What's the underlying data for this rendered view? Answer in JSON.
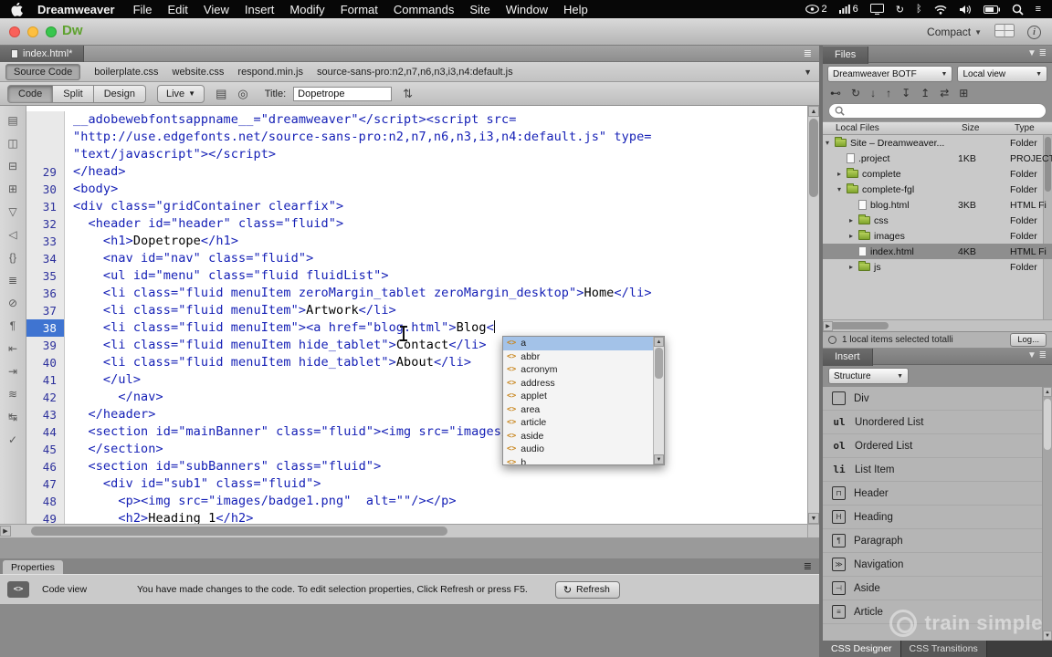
{
  "menubar": {
    "app_name": "Dreamweaver",
    "items": [
      "File",
      "Edit",
      "View",
      "Insert",
      "Modify",
      "Format",
      "Commands",
      "Site",
      "Window",
      "Help"
    ],
    "status": {
      "eye_badge": "2",
      "signal_badge": "6"
    }
  },
  "titlebar": {
    "logo": "Dw",
    "compact_label": "Compact"
  },
  "document": {
    "tab_label": "index.html*"
  },
  "related_files": {
    "source_code_label": "Source Code",
    "files": [
      "boilerplate.css",
      "website.css",
      "respond.min.js",
      "source-sans-pro:n2,n7,n6,n3,i3,n4:default.js"
    ]
  },
  "toolbar": {
    "code_label": "Code",
    "split_label": "Split",
    "design_label": "Design",
    "live_label": "Live",
    "title_label": "Title:",
    "title_value": "Dopetrope"
  },
  "code": {
    "left_toolbar_icons": [
      "open-documents",
      "show-code-navigator",
      "collapse-full-tag",
      "collapse-selection",
      "expand-all",
      "select-parent-tag",
      "balance-braces",
      "line-numbers",
      "highlight-invalid-code",
      "apply-comment",
      "indent-left",
      "indent-right",
      "wrap-tag",
      "move-css",
      "syntax-check"
    ],
    "lines": [
      {
        "n": "",
        "t": "__adobewebfontsappname__=\"dreamweaver\"</script><script src=",
        "m": true
      },
      {
        "n": "",
        "t": "\"http://use.edgefonts.net/source-sans-pro:n2,n7,n6,n3,i3,n4:default.js\" type=",
        "m": true
      },
      {
        "n": "",
        "t": "\"text/javascript\"></script>",
        "m": true
      },
      {
        "n": "29",
        "t": "</head>"
      },
      {
        "n": "30",
        "t": "<body>"
      },
      {
        "n": "31",
        "t": "<div class=\"gridContainer clearfix\">"
      },
      {
        "n": "32",
        "t": "  <header id=\"header\" class=\"fluid\">"
      },
      {
        "n": "33",
        "t": "    <h1>Dopetrope</h1>"
      },
      {
        "n": "34",
        "t": "    <nav id=\"nav\" class=\"fluid\">"
      },
      {
        "n": "35",
        "t": "    <ul id=\"menu\" class=\"fluid fluidList\">"
      },
      {
        "n": "36",
        "t": "    <li class=\"fluid menuItem zeroMargin_tablet zeroMargin_desktop\">Home</li>"
      },
      {
        "n": "37",
        "t": "    <li class=\"fluid menuItem\">Artwork</li>"
      },
      {
        "n": "38",
        "t": "    <li class=\"fluid menuItem\"><a href=\"blog.html\">Blog<",
        "cur": true,
        "caret": true
      },
      {
        "n": "39",
        "t": "    <li class=\"fluid menuItem hide_tablet\">Contact</li>"
      },
      {
        "n": "40",
        "t": "    <li class=\"fluid menuItem hide_tablet\">About</li>"
      },
      {
        "n": "41",
        "t": "    </ul>"
      },
      {
        "n": "42",
        "t": "      </nav>"
      },
      {
        "n": "43",
        "t": "  </header>"
      },
      {
        "n": "44",
        "t": "  <section id=\"mainBanner\" class=\"fluid\"><img src=\"images/banner_large.jpg\"/>"
      },
      {
        "n": "45",
        "t": "  </section>"
      },
      {
        "n": "46",
        "t": "  <section id=\"subBanners\" class=\"fluid\">"
      },
      {
        "n": "47",
        "t": "    <div id=\"sub1\" class=\"fluid\">"
      },
      {
        "n": "48",
        "t": "      <p><img src=\"images/badge1.png\"  alt=\"\"/></p>"
      },
      {
        "n": "49",
        "t": "      <h2>Heading 1</h2>"
      }
    ]
  },
  "hints": {
    "selected_index": 0,
    "items": [
      "a",
      "abbr",
      "acronym",
      "address",
      "applet",
      "area",
      "article",
      "aside",
      "audio",
      "b"
    ]
  },
  "files_panel": {
    "tab_label": "Files",
    "site_dropdown": "Dreamweaver BOTF",
    "view_dropdown": "Local view",
    "toolbar_icons": [
      "connect",
      "refresh",
      "get-files",
      "put-files",
      "check-out",
      "check-in",
      "synchronize",
      "expand"
    ],
    "columns": [
      "Local Files",
      "Size",
      "Type"
    ],
    "rows": [
      {
        "indent": 0,
        "arrow": "down",
        "icon": "folder",
        "name": "Site – Dreamweaver...",
        "size": "",
        "type": "Folder"
      },
      {
        "indent": 1,
        "arrow": "",
        "icon": "file",
        "name": ".project",
        "size": "1KB",
        "type": "PROJECT"
      },
      {
        "indent": 1,
        "arrow": "right",
        "icon": "folder",
        "name": "complete",
        "size": "",
        "type": "Folder"
      },
      {
        "indent": 1,
        "arrow": "down",
        "icon": "folder",
        "name": "complete-fgl",
        "size": "",
        "type": "Folder"
      },
      {
        "indent": 2,
        "arrow": "",
        "icon": "file",
        "name": "blog.html",
        "size": "3KB",
        "type": "HTML Fi"
      },
      {
        "indent": 2,
        "arrow": "right",
        "icon": "folder",
        "name": "css",
        "size": "",
        "type": "Folder"
      },
      {
        "indent": 2,
        "arrow": "right",
        "icon": "folder",
        "name": "images",
        "size": "",
        "type": "Folder"
      },
      {
        "indent": 2,
        "arrow": "",
        "icon": "file",
        "name": "index.html",
        "size": "4KB",
        "type": "HTML Fi",
        "selected": true
      },
      {
        "indent": 2,
        "arrow": "right",
        "icon": "folder",
        "name": "js",
        "size": "",
        "type": "Folder"
      }
    ],
    "status_text": "1 local items selected totalli",
    "log_label": "Log..."
  },
  "insert_panel": {
    "tab_label": "Insert",
    "category": "Structure",
    "items": [
      {
        "icon": "div",
        "label": "Div"
      },
      {
        "icon": "ul",
        "label": "Unordered List"
      },
      {
        "icon": "ol",
        "label": "Ordered List"
      },
      {
        "icon": "li",
        "label": "List Item"
      },
      {
        "icon": "header",
        "label": "Header"
      },
      {
        "icon": "heading",
        "label": "Heading"
      },
      {
        "icon": "paragraph",
        "label": "Paragraph"
      },
      {
        "icon": "navigation",
        "label": "Navigation"
      },
      {
        "icon": "aside",
        "label": "Aside"
      },
      {
        "icon": "article",
        "label": "Article"
      }
    ]
  },
  "properties_panel": {
    "tab_label": "Properties",
    "mode_label": "Code view",
    "message": "You have made changes to the code. To edit selection properties, Click Refresh or press F5.",
    "refresh_label": "Refresh"
  },
  "bottom_tabs": [
    "CSS Designer",
    "CSS Transitions"
  ],
  "watermark": "train simple"
}
